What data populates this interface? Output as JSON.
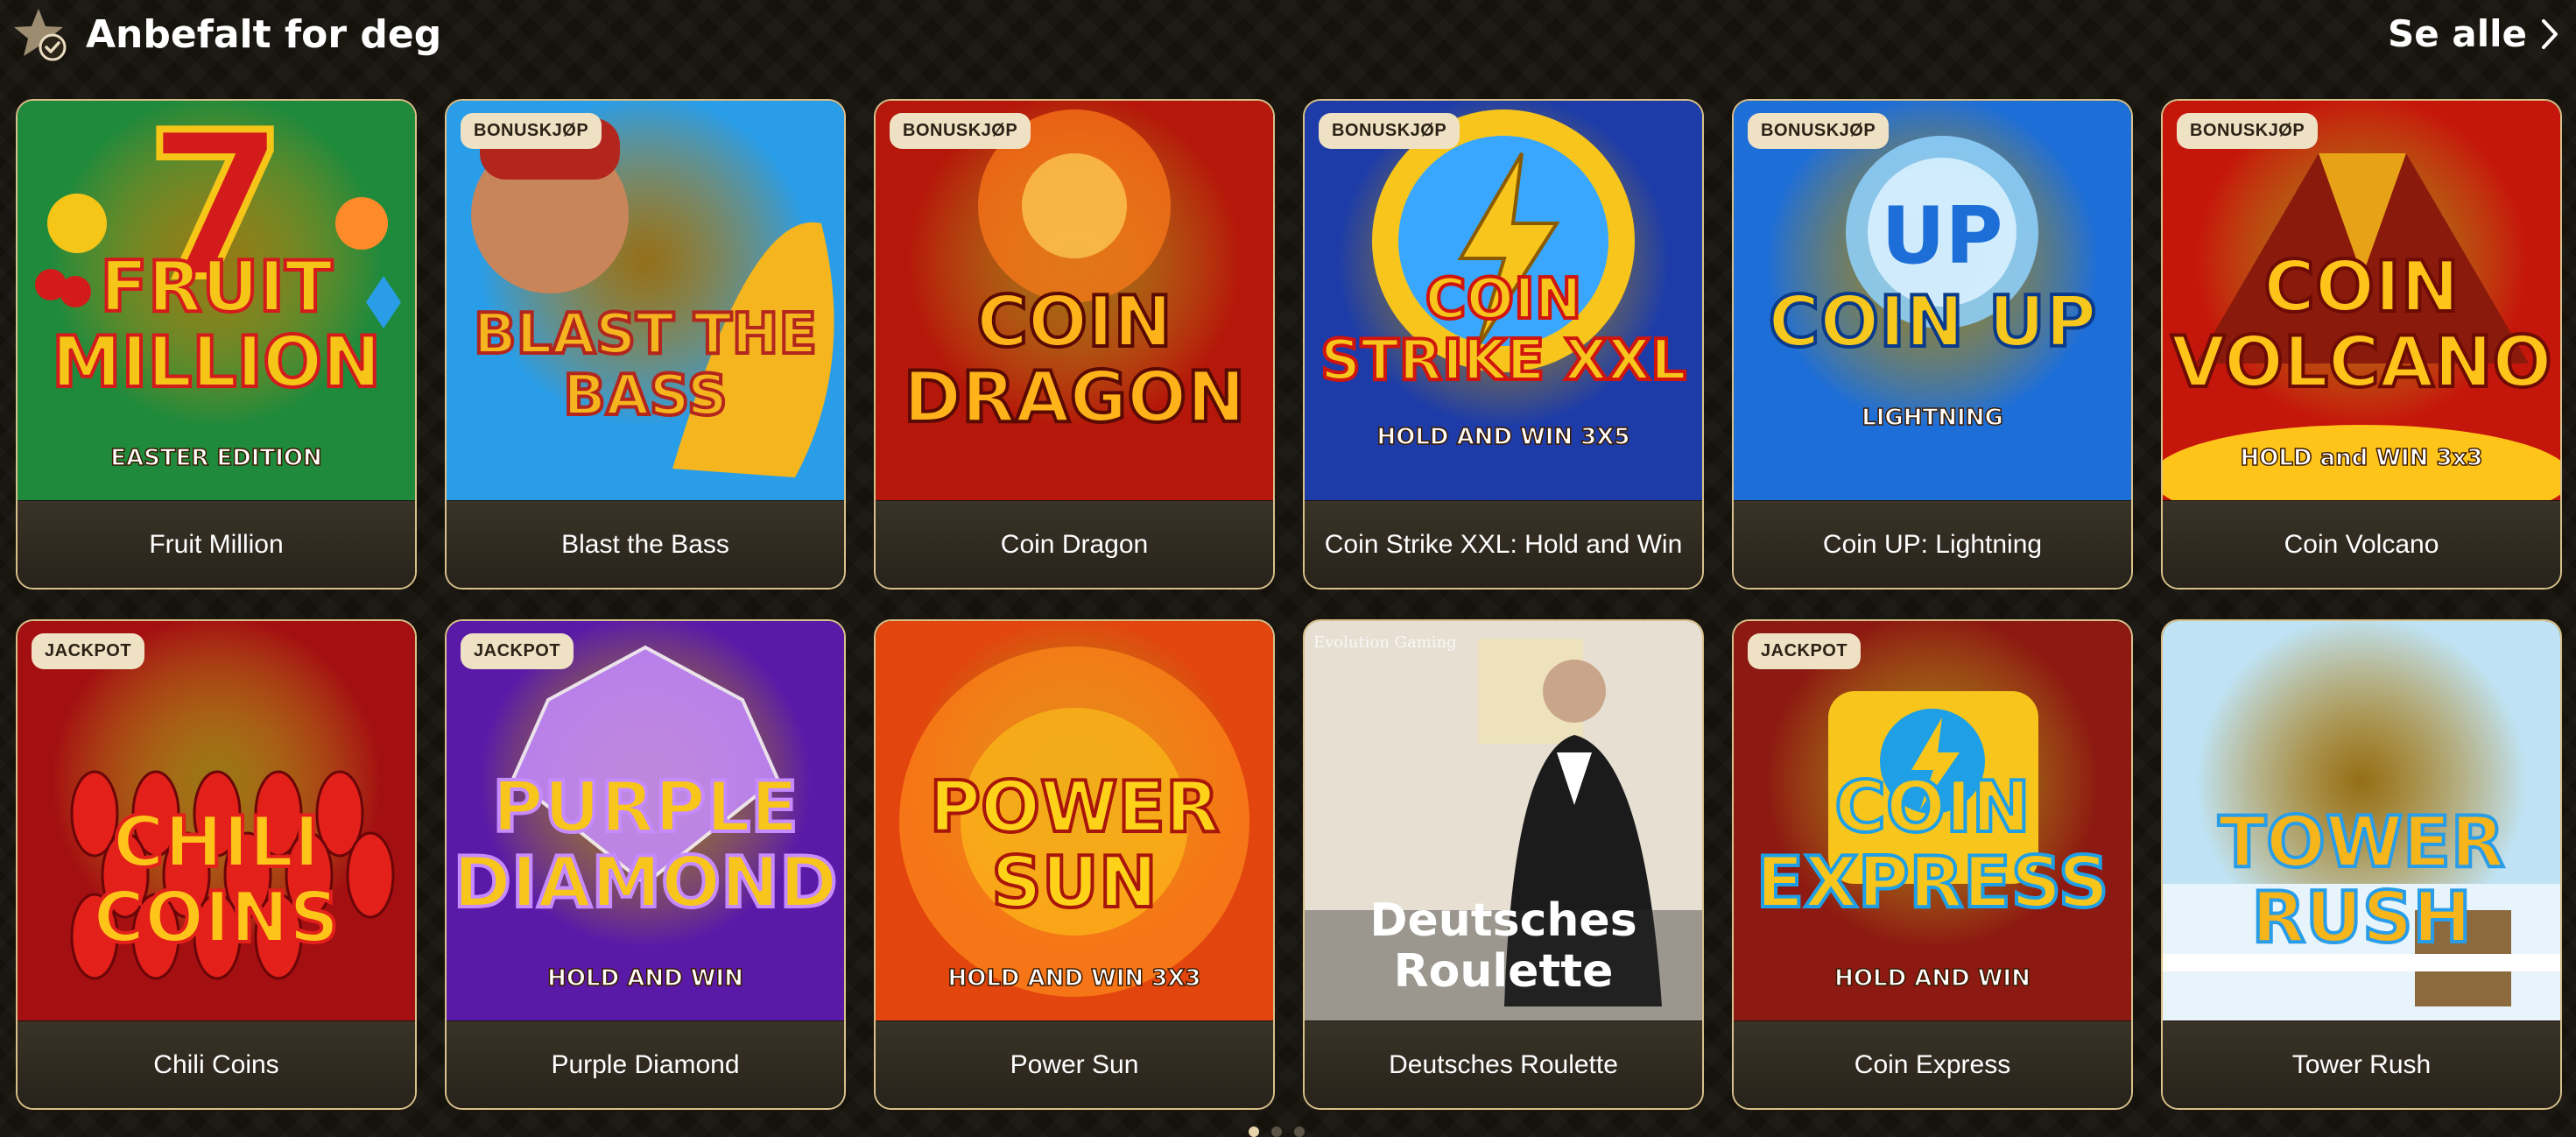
{
  "section": {
    "title": "Anbefalt for deg",
    "see_all_label": "Se alle"
  },
  "games": [
    {
      "name": "Fruit Million",
      "badge": "",
      "art_title": [
        "FRUIT",
        "MILLION"
      ],
      "art_sub": "EASTER EDITION",
      "theme": "fruit",
      "colors": [
        "#1f8a3c",
        "#f5c518",
        "#d31b1b"
      ]
    },
    {
      "name": "Blast the Bass",
      "badge": "BONUSKJØP",
      "art_title": [
        "BLAST THE",
        "BASS"
      ],
      "art_sub": "",
      "theme": "bass",
      "colors": [
        "#2a9de8",
        "#f5b51f",
        "#b3261e"
      ]
    },
    {
      "name": "Coin Dragon",
      "badge": "BONUSKJØP",
      "art_title": [
        "COIN",
        "DRAGON"
      ],
      "art_sub": "",
      "theme": "dragon",
      "colors": [
        "#b5180a",
        "#ffb31a",
        "#5a0a04"
      ]
    },
    {
      "name": "Coin Strike XXL: Hold and Win",
      "badge": "BONUSKJØP",
      "art_title": [
        "COIN",
        "STRIKE XXL"
      ],
      "art_sub": "HOLD AND WIN 3X5",
      "theme": "strike",
      "colors": [
        "#1d3ca8",
        "#f7c51c",
        "#d0150f"
      ]
    },
    {
      "name": "Coin UP: Lightning",
      "badge": "BONUSKJØP",
      "art_title": [
        "COIN UP"
      ],
      "art_sub": "LIGHTNING",
      "theme": "coinup",
      "colors": [
        "#1e6ed8",
        "#f6c81d",
        "#0b3a8a"
      ]
    },
    {
      "name": "Coin Volcano",
      "badge": "BONUSKJØP",
      "art_title": [
        "COIN",
        "VOLCANO"
      ],
      "art_sub": "HOLD and WIN 3x3",
      "theme": "volcano",
      "colors": [
        "#c5160b",
        "#ffc41a",
        "#6d0b05"
      ]
    },
    {
      "name": "Chili Coins",
      "badge": "JACKPOT",
      "art_title": [
        "CHILI",
        "COINS"
      ],
      "art_sub": "",
      "theme": "chili",
      "colors": [
        "#a40f12",
        "#ffc41a",
        "#e3201a"
      ]
    },
    {
      "name": "Purple Diamond",
      "badge": "JACKPOT",
      "art_title": [
        "PURPLE",
        "DIAMOND"
      ],
      "art_sub": "HOLD AND WIN",
      "theme": "diamond",
      "colors": [
        "#5a1aa8",
        "#f7c51c",
        "#c58bff"
      ]
    },
    {
      "name": "Power Sun",
      "badge": "",
      "art_title": [
        "POWER",
        "SUN"
      ],
      "art_sub": "HOLD AND WIN 3X3",
      "theme": "sun",
      "colors": [
        "#e2450e",
        "#ffd21a",
        "#a8150a"
      ]
    },
    {
      "name": "Deutsches Roulette",
      "badge": "",
      "art_title": [
        "Deutsches",
        "Roulette"
      ],
      "art_sub": "Evolution Gaming",
      "theme": "roulette",
      "colors": [
        "#d9d2c4",
        "#1b1b1b",
        "#ffffff"
      ]
    },
    {
      "name": "Coin Express",
      "badge": "JACKPOT",
      "art_title": [
        "COIN",
        "EXPRESS"
      ],
      "art_sub": "HOLD AND WIN",
      "theme": "express",
      "colors": [
        "#8d1a12",
        "#f7c51c",
        "#1fa0e6"
      ]
    },
    {
      "name": "Tower Rush",
      "badge": "",
      "art_title": [
        "TOWER",
        "RUSH"
      ],
      "art_sub": "",
      "theme": "tower",
      "colors": [
        "#bfe3f4",
        "#f7b51c",
        "#2a9de8"
      ]
    }
  ],
  "pager": {
    "pages": 3,
    "active": 1
  }
}
